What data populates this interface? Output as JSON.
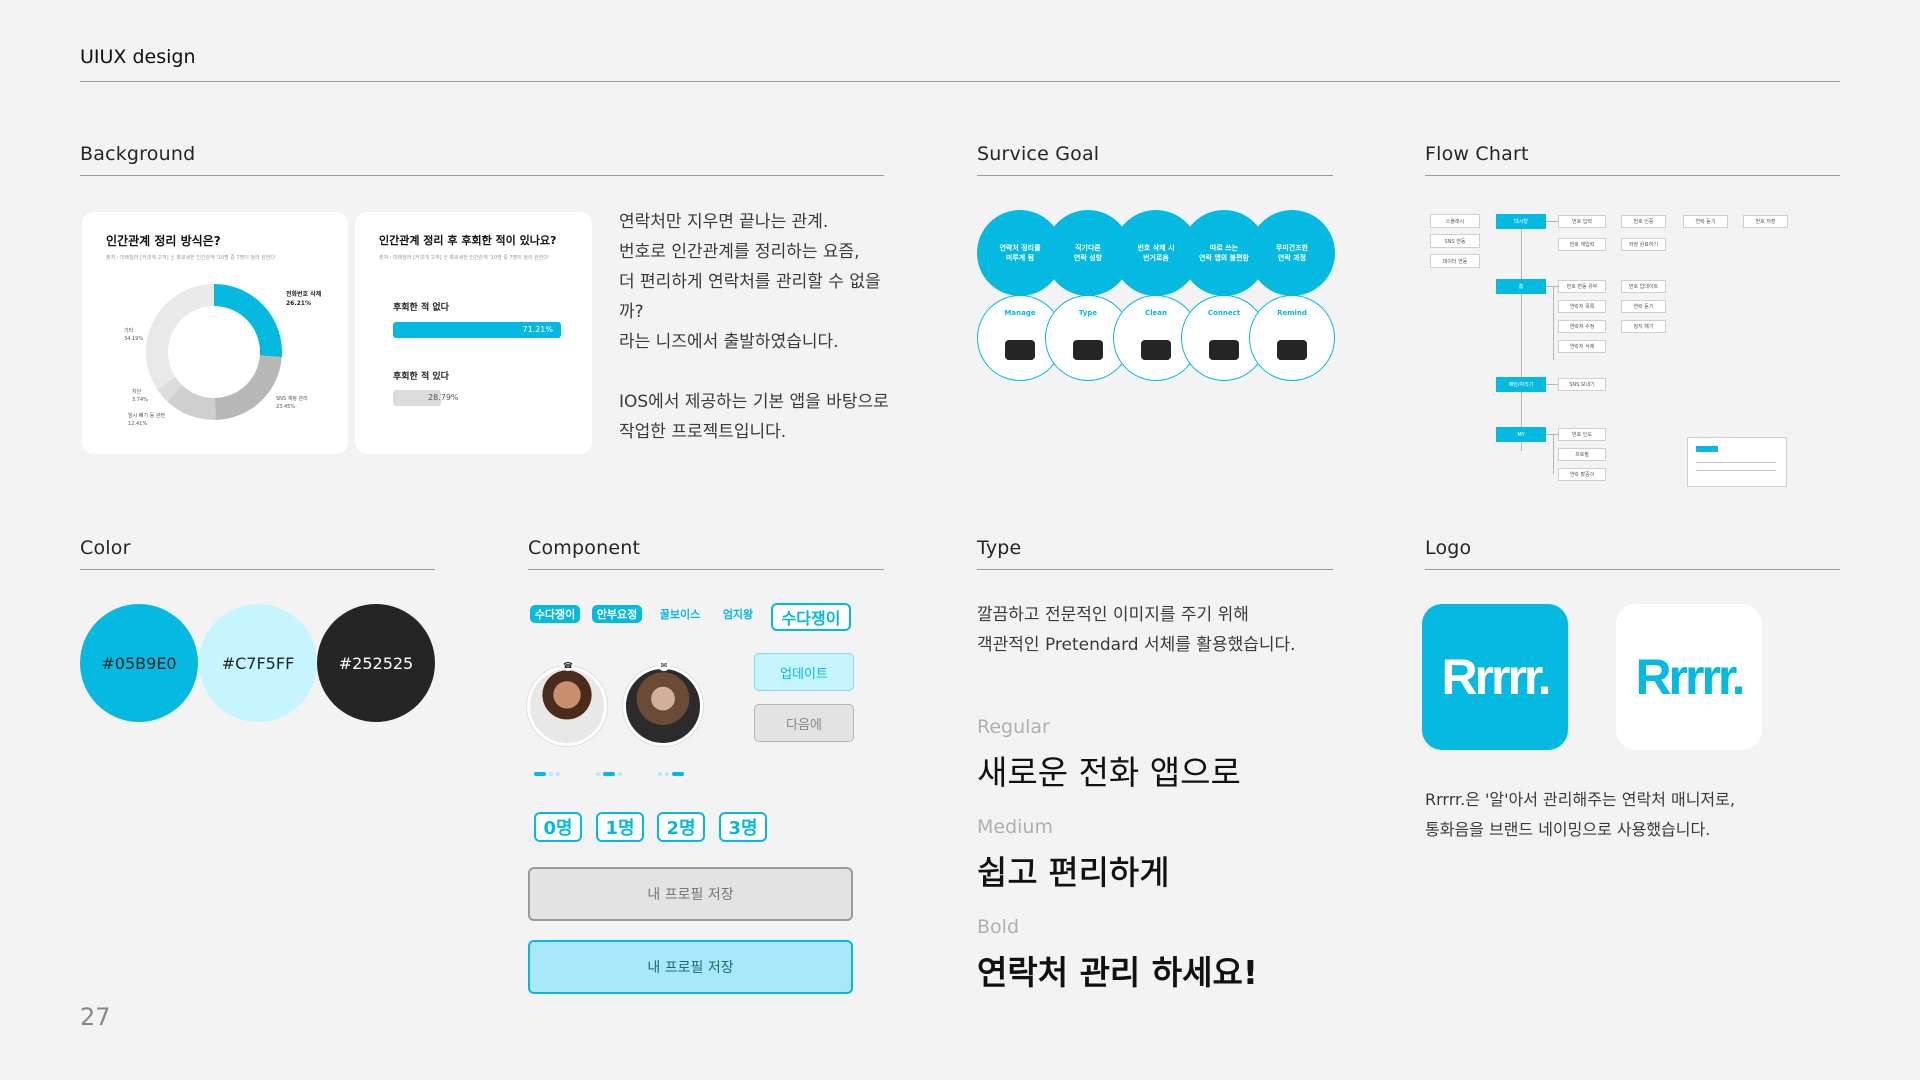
{
  "header": {
    "title": "UIUX design"
  },
  "page_number": "27",
  "colors": {
    "primary": "#05B9E0",
    "light": "#C7F5FF",
    "dark": "#252525"
  },
  "background": {
    "title": "Background",
    "card1": {
      "title": "인간관계 정리 방식은?",
      "source": "출처 : 미래질러 [커넷게 고객] 신 혹쿄세한 인간관계 '10명 중 7명이 정리 원한다'",
      "labels": [
        {
          "text": "전화번호 삭제",
          "value": "26.21%"
        },
        {
          "text": "기타",
          "value": "34.19%"
        },
        {
          "text": "차단",
          "value": "3.74%"
        },
        {
          "text": "SNS 계정 관리",
          "value": "23.45%"
        },
        {
          "text": "임시 빼기 등 관련",
          "value": "12.41%"
        }
      ],
      "donut": [
        {
          "name": "전화번호 삭제",
          "value": 26.21,
          "color": "#05B9E0"
        },
        {
          "name": "SNS 계정 관리",
          "value": 23.45,
          "color": "#b8b8b8"
        },
        {
          "name": "임시 빼기 등 관련",
          "value": 12.41,
          "color": "#cfcfcf"
        },
        {
          "name": "차단",
          "value": 3.74,
          "color": "#dcdcdc"
        },
        {
          "name": "기타",
          "value": 34.19,
          "color": "#e9e9e9"
        }
      ]
    },
    "card2": {
      "title": "인간관계 정리 후 후회한 적이 있나요?",
      "source": "출처 : 미래질러 [커넷게 고객] 신 혹쿄세한 인간관계 '10명 중 7명이 정리 원한다'",
      "bar1": {
        "label": "후회한 적 없다",
        "value": "71.21%",
        "fraction": 0.7121
      },
      "bar2": {
        "label": "후회한 적 있다",
        "value": "28.79%",
        "fraction": 0.2879
      }
    },
    "text": "연락처만 지우면 끝나는 관계.\n번호로 인간관계를 정리하는 요즘,\n더 편리하게 연락처를 관리할 수 없을까?\n라는 니즈에서 출발하였습니다.\n\nIOS에서 제공하는 기본 앱을 바탕으로\n작업한 프로젝트입니다."
  },
  "service_goal": {
    "title": "Survice Goal",
    "top": [
      "연락처 정리를\n미루게 됨",
      "직기다른\n연락 성향",
      "번호 삭제 시\n번거로움",
      "따로 쓰는\n연락 앱의 불편함",
      "무미건조한\n연락 과정"
    ],
    "bottom": [
      "Manage",
      "Type",
      "Clean",
      "Connect",
      "Remind"
    ]
  },
  "flow_chart": {
    "title": "Flow Chart",
    "left_boxes": [
      "스플래시",
      "SNS 연동",
      "데이터 연동"
    ],
    "main_nodes": [
      "대시형",
      "홈",
      "패턴/차리기",
      "MY"
    ],
    "nodes": [
      "번호 입력",
      "번호 재입력",
      "번호 인증",
      "연락처 홈",
      "번호 변동 유무",
      "연락처 목록",
      "연락처 수정",
      "연락처 삭제",
      "SNS 보내기",
      "번호 인도",
      "프로필",
      "연락 할중이",
      "연락 듣기",
      "번호 저장",
      "수신 듣기",
      "저장 완료하기",
      "번호 업데이트",
      "연락 듣기",
      "정지 해기"
    ]
  },
  "color_section": {
    "title": "Color",
    "swatches": [
      {
        "hex": "#05B9E0",
        "text_color": "#252525"
      },
      {
        "hex": "#C7F5FF",
        "text_color": "#252525"
      },
      {
        "hex": "#252525",
        "text_color": "#ffffff"
      }
    ]
  },
  "component": {
    "title": "Component",
    "chips": [
      "수다쟁이",
      "안부요정",
      "꿀보이스",
      "엄지왕"
    ],
    "chip_large": "수다쟁이",
    "update": "업데이트",
    "next": "다음에",
    "counts": [
      "0명",
      "1명",
      "2명",
      "3명"
    ],
    "save_disabled": "내 프로필 저장",
    "save_active": "내 프로필 저장"
  },
  "type": {
    "title": "Type",
    "desc": "깔끔하고 전문적인 이미지를 주기 위해\n객관적인 Pretendard 서체를 활용했습니다.",
    "regular_label": "Regular",
    "regular_sample": "새로운 전화 앱으로",
    "medium_label": "Medium",
    "medium_sample": "쉽고 편리하게",
    "bold_label": "Bold",
    "bold_sample": "연락처 관리 하세요!"
  },
  "logo": {
    "title": "Logo",
    "wordmark": "Rrrrr.",
    "desc": "Rrrrr.은 '알'아서 관리해주는 연락처 매니저로,\n통화음을 브랜드 네이밍으로 사용했습니다."
  }
}
